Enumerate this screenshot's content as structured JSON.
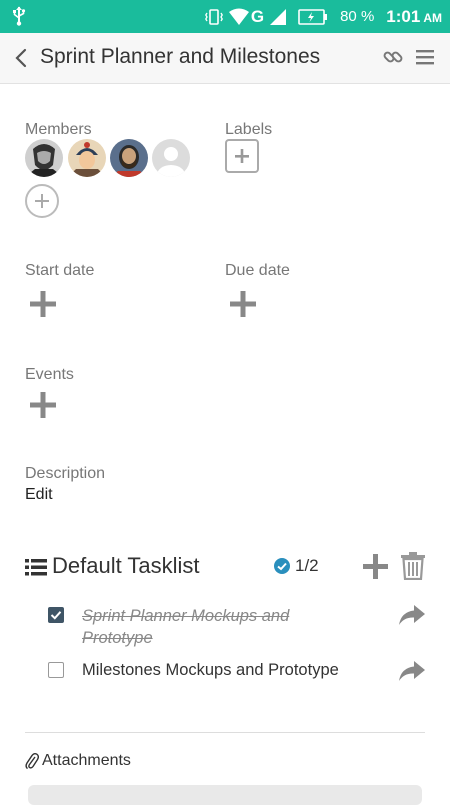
{
  "status_bar": {
    "battery_percent": "80 %",
    "time": "1:01",
    "ampm": "AM",
    "network": "G"
  },
  "header": {
    "title": "Sprint Planner and Milestones"
  },
  "members": {
    "label": "Members",
    "count": 4
  },
  "labels": {
    "label": "Labels"
  },
  "dates": {
    "start_label": "Start date",
    "due_label": "Due date"
  },
  "events": {
    "label": "Events"
  },
  "description": {
    "label": "Description",
    "value": "Edit"
  },
  "tasklist": {
    "title": "Default Tasklist",
    "progress": "1/2",
    "tasks": [
      {
        "line1": "Sprint Planner Mockups and",
        "line2": "Prototype",
        "done": true
      },
      {
        "line1": "Milestones Mockups and Prototype",
        "done": false
      }
    ]
  },
  "attachments": {
    "label": "Attachments"
  },
  "colors": {
    "status_bar": "#1abc9c",
    "checkbox_checked": "#3f5566",
    "check_badge": "#2a8fbd"
  }
}
